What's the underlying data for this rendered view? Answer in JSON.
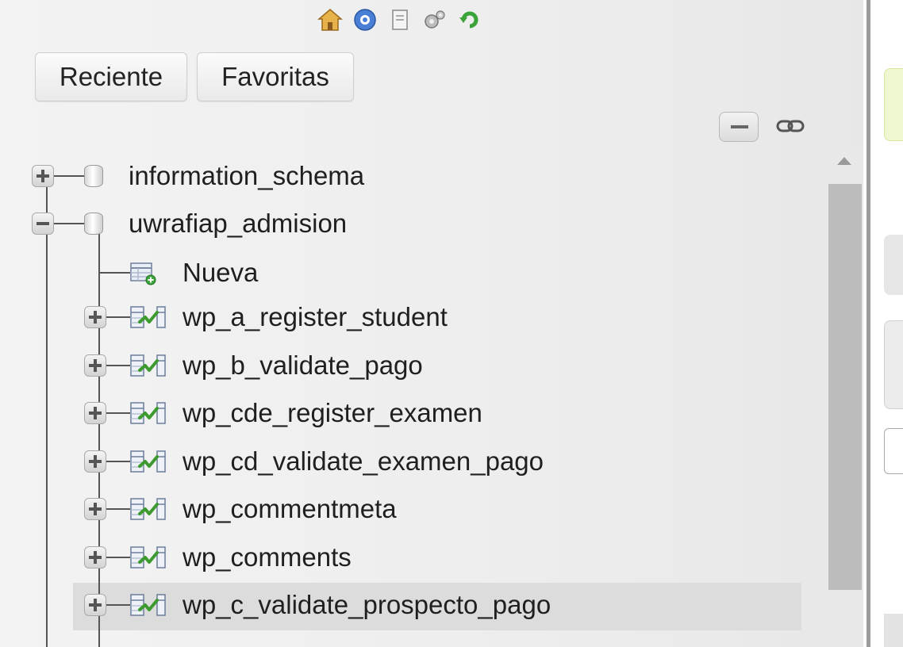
{
  "toplinks": [
    "home-icon",
    "help-icon",
    "docs-icon",
    "settings-icon",
    "reload-icon"
  ],
  "tabs": {
    "recent": "Reciente",
    "favorites": "Favoritas"
  },
  "tree": {
    "databases": [
      "information_schema",
      "uwrafiap_admision"
    ],
    "new_label": "Nueva",
    "tables": [
      "wp_a_register_student",
      "wp_b_validate_pago",
      "wp_cde_register_examen",
      "wp_cd_validate_examen_pago",
      "wp_commentmeta",
      "wp_comments",
      "wp_c_validate_prospecto_pago"
    ]
  },
  "colors": {
    "panel_bg": "#ececec",
    "highlight": "#dcdcdc",
    "accent_green": "#3c9a2e"
  }
}
